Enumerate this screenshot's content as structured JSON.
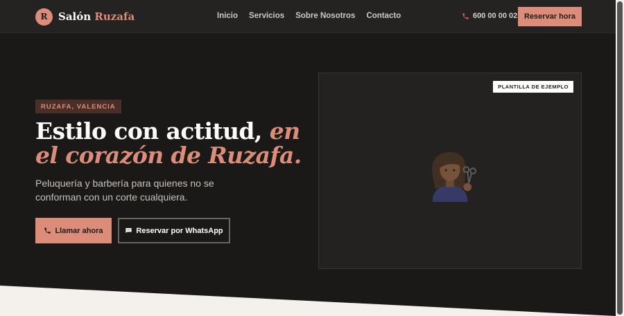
{
  "brand": {
    "mark": "R",
    "name_part1": "Salón",
    "name_part2": "Ruzafa"
  },
  "nav": {
    "links": [
      "Inicio",
      "Servicios",
      "Sobre Nosotros",
      "Contacto"
    ]
  },
  "header": {
    "phone": "600 00 00 02",
    "reserve_label": "Reservar hora"
  },
  "hero": {
    "tag": "RUZAFA, VALENCIA",
    "headline_plain": "Estilo con actitud,",
    "headline_accent": "en el corazón de Ruzafa.",
    "subtitle": "Peluquería y barbería para quienes no se conforman con un corte cualquiera.",
    "call_label": "Llamar ahora",
    "whatsapp_label": "Reservar por WhatsApp"
  },
  "media": {
    "badge": "PLANTILLA DE EJEMPLO",
    "icon": "hairdresser-icon"
  },
  "icons": {
    "phone": "phone-icon",
    "chat": "chat-icon"
  },
  "colors": {
    "accent": "#dc8d79",
    "background": "#1b1918",
    "navbar": "#252322",
    "tag_background": "#4a2f29",
    "light_section": "#f4f1ec"
  }
}
